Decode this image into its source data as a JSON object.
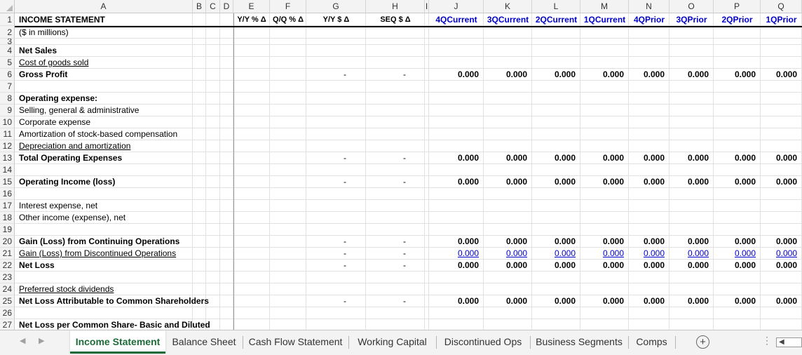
{
  "columns": [
    {
      "letter": "A"
    },
    {
      "letter": "B"
    },
    {
      "letter": "C"
    },
    {
      "letter": "D"
    },
    {
      "letter": "E"
    },
    {
      "letter": "F"
    },
    {
      "letter": "G"
    },
    {
      "letter": "H"
    },
    {
      "letter": "I"
    },
    {
      "letter": "J"
    },
    {
      "letter": "K"
    },
    {
      "letter": "L"
    },
    {
      "letter": "M"
    },
    {
      "letter": "N"
    },
    {
      "letter": "O"
    },
    {
      "letter": "P"
    },
    {
      "letter": "Q"
    }
  ],
  "header_row": {
    "title": "INCOME STATEMENT",
    "E": "Y/Y % Δ",
    "F": "Q/Q % Δ",
    "G": "Y/Y $ Δ",
    "H": "SEQ $ Δ",
    "periods": [
      "4QCurrent",
      "3QCurrent",
      "2QCurrent",
      "1QCurrent",
      "4QPrior",
      "3QPrior",
      "2QPrior",
      "1QPrior"
    ]
  },
  "rows": [
    {
      "n": "1"
    },
    {
      "n": "2",
      "label": "($ in millions)"
    },
    {
      "n": "3"
    },
    {
      "n": "4",
      "label": "Net Sales",
      "bold": true
    },
    {
      "n": "5",
      "label": "Cost of goods sold",
      "ul": true
    },
    {
      "n": "6",
      "label": "Gross Profit",
      "bold": true,
      "dashes": true,
      "values": [
        "0.000",
        "0.000",
        "0.000",
        "0.000",
        "0.000",
        "0.000",
        "0.000",
        "0.000"
      ]
    },
    {
      "n": "7"
    },
    {
      "n": "8",
      "label": "Operating expense:",
      "bold": true
    },
    {
      "n": "9",
      "label": "Selling, general & administrative"
    },
    {
      "n": "10",
      "label": "Corporate expense"
    },
    {
      "n": "11",
      "label": "Amortization of stock-based compensation"
    },
    {
      "n": "12",
      "label": "Depreciation and amortization",
      "ul": true
    },
    {
      "n": "13",
      "label": "Total Operating Expenses",
      "bold": true,
      "dashes": true,
      "values": [
        "0.000",
        "0.000",
        "0.000",
        "0.000",
        "0.000",
        "0.000",
        "0.000",
        "0.000"
      ]
    },
    {
      "n": "14"
    },
    {
      "n": "15",
      "label": "Operating Income (loss)",
      "bold": true,
      "dashes": true,
      "values": [
        "0.000",
        "0.000",
        "0.000",
        "0.000",
        "0.000",
        "0.000",
        "0.000",
        "0.000"
      ]
    },
    {
      "n": "16"
    },
    {
      "n": "17",
      "label": "Interest expense, net"
    },
    {
      "n": "18",
      "label": "Other income (expense), net"
    },
    {
      "n": "19"
    },
    {
      "n": "20",
      "label": "Gain (Loss) from Continuing Operations",
      "bold": true,
      "dashes": true,
      "values": [
        "0.000",
        "0.000",
        "0.000",
        "0.000",
        "0.000",
        "0.000",
        "0.000",
        "0.000"
      ]
    },
    {
      "n": "21",
      "label": "Gain (Loss) from Discontinued Operations",
      "ul": true,
      "dashes": true,
      "values": [
        "0.000",
        "0.000",
        "0.000",
        "0.000",
        "0.000",
        "0.000",
        "0.000",
        "0.000"
      ],
      "valul": true
    },
    {
      "n": "22",
      "label": "Net Loss",
      "bold": true,
      "dashes": true,
      "values": [
        "0.000",
        "0.000",
        "0.000",
        "0.000",
        "0.000",
        "0.000",
        "0.000",
        "0.000"
      ]
    },
    {
      "n": "23"
    },
    {
      "n": "24",
      "label": "Preferred stock dividends",
      "ul": true
    },
    {
      "n": "25",
      "label": "Net Loss Attributable to Common Shareholders",
      "bold": true,
      "dashes": true,
      "values": [
        "0.000",
        "0.000",
        "0.000",
        "0.000",
        "0.000",
        "0.000",
        "0.000",
        "0.000"
      ]
    },
    {
      "n": "26"
    },
    {
      "n": "27",
      "label": "Net Loss per Common Share- Basic and Diluted",
      "bold": true
    }
  ],
  "dash": "-",
  "tabs": [
    {
      "label": "Income Statement",
      "active": true
    },
    {
      "label": "Balance Sheet"
    },
    {
      "label": "Cash Flow Statement"
    },
    {
      "label": "Working Capital"
    },
    {
      "label": "Discontinued Ops"
    },
    {
      "label": "Business Segments"
    },
    {
      "label": "Comps"
    }
  ],
  "add_sheet_icon": "plus-circle-icon",
  "colors": {
    "accent": "#1e6b3a",
    "period_header": "#0000cc",
    "value_link": "#0000cc"
  }
}
